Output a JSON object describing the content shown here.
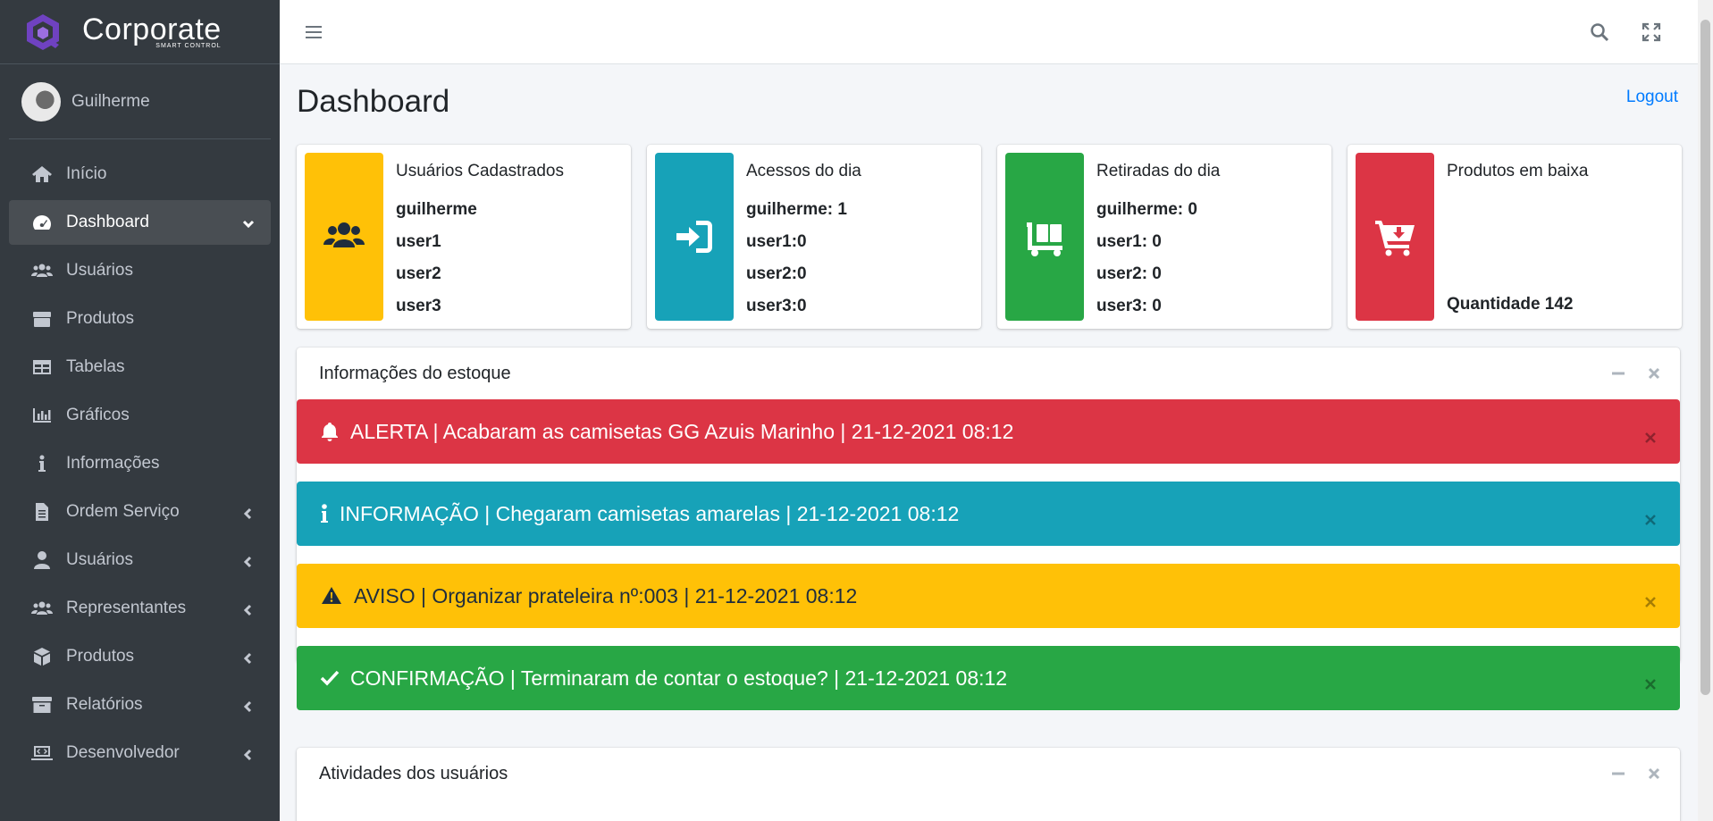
{
  "brand": {
    "title": "Corporate",
    "subtitle": "SMART CONTROL"
  },
  "user": {
    "name": "Guilherme"
  },
  "sidebar": {
    "items": [
      {
        "label": "Início",
        "icon": "home-icon"
      },
      {
        "label": "Dashboard",
        "icon": "dashboard-icon"
      },
      {
        "label": "Usuários",
        "icon": "users-icon"
      },
      {
        "label": "Produtos",
        "icon": "box-icon"
      },
      {
        "label": "Tabelas",
        "icon": "table-icon"
      },
      {
        "label": "Gráficos",
        "icon": "chart-icon"
      },
      {
        "label": "Informações",
        "icon": "info-icon"
      },
      {
        "label": "Ordem Serviço",
        "icon": "file-icon"
      },
      {
        "label": "Usuários",
        "icon": "user-icon"
      },
      {
        "label": "Representantes",
        "icon": "users-icon"
      },
      {
        "label": "Produtos",
        "icon": "cube-icon"
      },
      {
        "label": "Relatórios",
        "icon": "archive-icon"
      },
      {
        "label": "Desenvolvedor",
        "icon": "laptop-code-icon"
      }
    ]
  },
  "main": {
    "title": "Dashboard",
    "logout_label": "Logout"
  },
  "cards": [
    {
      "title": "Usuários Cadastrados",
      "lines": [
        "guilherme",
        "user1",
        "user2",
        "user3"
      ],
      "color": "#ffc107",
      "icon": "users-icon"
    },
    {
      "title": "Acessos do dia",
      "lines": [
        "guilherme: 1",
        "user1:0",
        "user2:0",
        "user3:0"
      ],
      "color": "#17a2b8",
      "icon": "sign-in-icon"
    },
    {
      "title": "Retiradas do dia",
      "lines": [
        "guilherme: 0",
        "user1: 0",
        "user2: 0",
        "user3: 0"
      ],
      "color": "#28a745",
      "icon": "dolly-icon"
    },
    {
      "title": "Produtos em baixa",
      "lines": [
        "Quantidade 142"
      ],
      "color": "#dc3545",
      "icon": "cart-arrow-down-icon"
    }
  ],
  "stock_panel": {
    "title": "Informações do estoque",
    "alerts": [
      {
        "text": "ALERTA | Acabaram as camisetas GG Azuis Marinho | 21-12-2021 08:12",
        "color": "#dc3545",
        "icon": "bell-icon"
      },
      {
        "text": "INFORMAÇÃO | Chegaram camisetas amarelas | 21-12-2021 08:12",
        "color": "#17a2b8",
        "icon": "info-icon"
      },
      {
        "text": "AVISO | Organizar prateleira nº:003 | 21-12-2021 08:12",
        "color": "#ffc107",
        "icon": "warning-icon"
      },
      {
        "text": "CONFIRMAÇÃO | Terminaram de contar o estoque? | 21-12-2021 08:12",
        "color": "#28a745",
        "icon": "check-icon"
      }
    ]
  },
  "activity_panel": {
    "title": "Atividades dos usuários"
  }
}
